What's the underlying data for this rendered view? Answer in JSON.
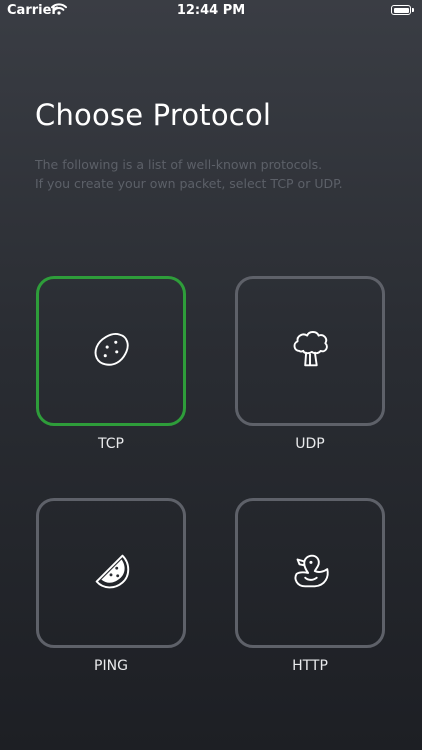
{
  "status_bar": {
    "carrier": "Carrier",
    "time": "12:44 PM"
  },
  "page": {
    "title": "Choose Protocol",
    "description_line1": "The following is a list of well-known protocols.",
    "description_line2": "If you create your own packet, select TCP or UDP."
  },
  "protocols": [
    {
      "label": "TCP",
      "icon": "potato-icon",
      "selected": true
    },
    {
      "label": "UDP",
      "icon": "broccoli-icon",
      "selected": false
    },
    {
      "label": "PING",
      "icon": "watermelon-icon",
      "selected": false
    },
    {
      "label": "HTTP",
      "icon": "duck-icon",
      "selected": false
    }
  ],
  "colors": {
    "selected_border": "#2e9d3a",
    "card_border": "#5e6169",
    "description_text": "#5c6068"
  }
}
